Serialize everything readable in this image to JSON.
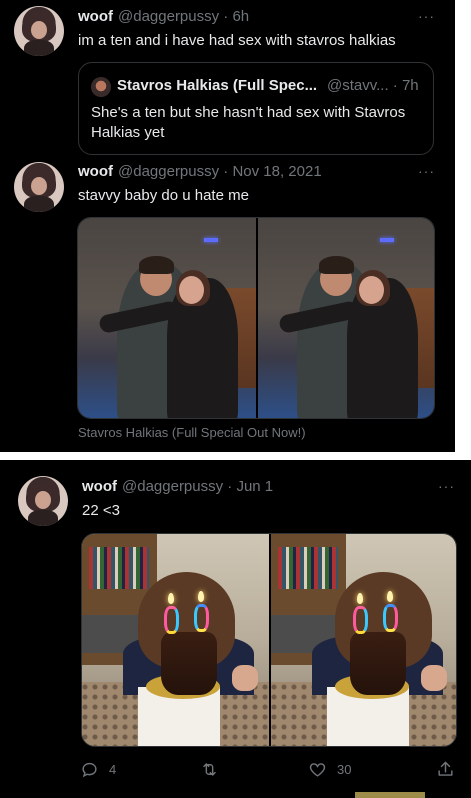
{
  "tweet1": {
    "display_name": "woof",
    "meta": "@daggerpussy · 6h",
    "text": "im a ten and i have had sex with stavros halkias",
    "more": "···",
    "quote": {
      "display_name": "Stavros Halkias (Full Spec...",
      "meta": "@stavv... · 7h",
      "text": "She's a ten but she hasn't had sex with Stavros Halkias yet"
    }
  },
  "tweet2": {
    "display_name": "woof",
    "meta": "@daggerpussy · Nov 18, 2021",
    "text": "stavvy baby do u hate me",
    "more": "···",
    "media_caption": "Stavros Halkias (Full Special Out Now!)"
  },
  "tweet3": {
    "display_name": "woof",
    "meta": "@daggerpussy · Jun 1",
    "text": "22 <3",
    "more": "···",
    "actions": {
      "reply_count": "4",
      "retweet_count": "",
      "like_count": "30"
    }
  },
  "icons": {
    "reply": "reply-icon",
    "retweet": "retweet-icon",
    "like": "heart-icon",
    "share": "share-icon",
    "more": "more-dots-icon"
  },
  "colors": {
    "background": "#000000",
    "text_primary": "#e7e9ea",
    "text_secondary": "#71767b",
    "border": "#2f3336"
  }
}
